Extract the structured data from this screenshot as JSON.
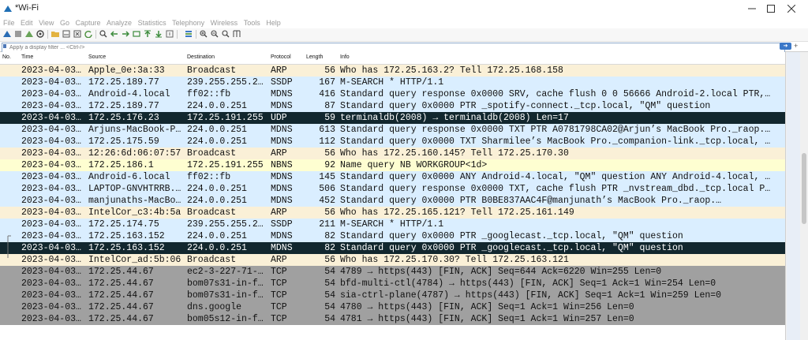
{
  "window": {
    "title": "*Wi-Fi"
  },
  "menu": [
    "File",
    "Edit",
    "View",
    "Go",
    "Capture",
    "Analyze",
    "Statistics",
    "Telephony",
    "Wireless",
    "Tools",
    "Help"
  ],
  "filter": {
    "placeholder": "Apply a display filter ... <Ctrl-/>"
  },
  "columns": {
    "no": "No.",
    "time": "Time",
    "source": "Source",
    "destination": "Destination",
    "protocol": "Protocol",
    "length": "Length",
    "info": "Info"
  },
  "colors": {
    "arp": "#faf0d7",
    "udp_blue": "#daeeff",
    "nbns": "#fefed1",
    "tcp_fin": "#a0a0a0",
    "selected": "#12272e",
    "selected_text": "#ffffff"
  },
  "rows": [
    {
      "time": "2023-04-03…",
      "source": "Apple_0e:3a:33",
      "destination": "Broadcast",
      "protocol": "ARP",
      "length": "56",
      "info": "Who has 172.25.163.2? Tell 172.25.168.158",
      "style": "arp"
    },
    {
      "time": "2023-04-03…",
      "source": "172.25.189.77",
      "destination": "239.255.255.2…",
      "protocol": "SSDP",
      "length": "167",
      "info": "M-SEARCH * HTTP/1.1",
      "style": "udp_blue"
    },
    {
      "time": "2023-04-03…",
      "source": "Android-4.local",
      "destination": "ff02::fb",
      "protocol": "MDNS",
      "length": "416",
      "info": "Standard query response 0x0000 SRV, cache flush 0 0 56666 Android-2.local PTR,…",
      "style": "udp_blue"
    },
    {
      "time": "2023-04-03…",
      "source": "172.25.189.77",
      "destination": "224.0.0.251",
      "protocol": "MDNS",
      "length": "87",
      "info": "Standard query 0x0000 PTR _spotify-connect._tcp.local, \"QM\" question",
      "style": "udp_blue"
    },
    {
      "time": "2023-04-03…",
      "source": "172.25.176.23",
      "destination": "172.25.191.255",
      "protocol": "UDP",
      "length": "59",
      "info": "terminaldb(2008) → terminaldb(2008) Len=17",
      "style": "selected"
    },
    {
      "time": "2023-04-03…",
      "source": "Arjuns-MacBook-P…",
      "destination": "224.0.0.251",
      "protocol": "MDNS",
      "length": "613",
      "info": "Standard query response 0x0000 TXT PTR A0781798CA02@Arjun’s MacBook Pro._raop.…",
      "style": "udp_blue"
    },
    {
      "time": "2023-04-03…",
      "source": "172.25.175.59",
      "destination": "224.0.0.251",
      "protocol": "MDNS",
      "length": "112",
      "info": "Standard query 0x0000 TXT Sharmilee’s MacBook Pro._companion-link._tcp.local, …",
      "style": "udp_blue"
    },
    {
      "time": "2023-04-03…",
      "source": "12:26:6d:06:07:57",
      "destination": "Broadcast",
      "protocol": "ARP",
      "length": "56",
      "info": "Who has 172.25.160.145? Tell 172.25.170.30",
      "style": "arp"
    },
    {
      "time": "2023-04-03…",
      "source": "172.25.186.1",
      "destination": "172.25.191.255",
      "protocol": "NBNS",
      "length": "92",
      "info": "Name query NB WORKGROUP<1d>",
      "style": "nbns"
    },
    {
      "time": "2023-04-03…",
      "source": "Android-6.local",
      "destination": "ff02::fb",
      "protocol": "MDNS",
      "length": "145",
      "info": "Standard query 0x0000 ANY Android-4.local, \"QM\" question ANY Android-4.local, …",
      "style": "udp_blue"
    },
    {
      "time": "2023-04-03…",
      "source": "LAPTOP-GNVHTRRB.…",
      "destination": "224.0.0.251",
      "protocol": "MDNS",
      "length": "506",
      "info": "Standard query response 0x0000 TXT, cache flush PTR _nvstream_dbd._tcp.local P…",
      "style": "udp_blue"
    },
    {
      "time": "2023-04-03…",
      "source": "manjunaths-MacBo…",
      "destination": "224.0.0.251",
      "protocol": "MDNS",
      "length": "452",
      "info": "Standard query 0x0000 PTR B0BE837AAC4F@manjunath’s MacBook Pro._raop.…",
      "style": "udp_blue"
    },
    {
      "time": "2023-04-03…",
      "source": "IntelCor_c3:4b:5a",
      "destination": "Broadcast",
      "protocol": "ARP",
      "length": "56",
      "info": "Who has 172.25.165.121? Tell 172.25.161.149",
      "style": "arp"
    },
    {
      "time": "2023-04-03…",
      "source": "172.25.174.75",
      "destination": "239.255.255.2…",
      "protocol": "SSDP",
      "length": "211",
      "info": "M-SEARCH * HTTP/1.1",
      "style": "udp_blue"
    },
    {
      "time": "2023-04-03…",
      "source": "172.25.163.152",
      "destination": "224.0.0.251",
      "protocol": "MDNS",
      "length": "82",
      "info": "Standard query 0x0000 PTR _googlecast._tcp.local, \"QM\" question",
      "style": "udp_blue"
    },
    {
      "time": "2023-04-03…",
      "source": "172.25.163.152",
      "destination": "224.0.0.251",
      "protocol": "MDNS",
      "length": "82",
      "info": "Standard query 0x0000 PTR _googlecast._tcp.local, \"QM\" question",
      "style": "selected"
    },
    {
      "time": "2023-04-03…",
      "source": "IntelCor_ad:5b:06",
      "destination": "Broadcast",
      "protocol": "ARP",
      "length": "56",
      "info": "Who has 172.25.170.30? Tell 172.25.163.121",
      "style": "arp"
    },
    {
      "time": "2023-04-03…",
      "source": "172.25.44.67",
      "destination": "ec2-3-227-71-…",
      "protocol": "TCP",
      "length": "54",
      "info": "4789 → https(443) [FIN, ACK] Seq=644 Ack=6220 Win=255 Len=0",
      "style": "tcp_fin"
    },
    {
      "time": "2023-04-03…",
      "source": "172.25.44.67",
      "destination": "bom07s31-in-f…",
      "protocol": "TCP",
      "length": "54",
      "info": "bfd-multi-ctl(4784) → https(443) [FIN, ACK] Seq=1 Ack=1 Win=254 Len=0",
      "style": "tcp_fin"
    },
    {
      "time": "2023-04-03…",
      "source": "172.25.44.67",
      "destination": "bom07s31-in-f…",
      "protocol": "TCP",
      "length": "54",
      "info": "sia-ctrl-plane(4787) → https(443) [FIN, ACK] Seq=1 Ack=1 Win=259 Len=0",
      "style": "tcp_fin"
    },
    {
      "time": "2023-04-03…",
      "source": "172.25.44.67",
      "destination": "dns.google",
      "protocol": "TCP",
      "length": "54",
      "info": "4780 → https(443) [FIN, ACK] Seq=1 Ack=1 Win=256 Len=0",
      "style": "tcp_fin"
    },
    {
      "time": "2023-04-03…",
      "source": "172.25.44.67",
      "destination": "bom05s12-in-f…",
      "protocol": "TCP",
      "length": "54",
      "info": "4781 → https(443) [FIN, ACK] Seq=1 Ack=1 Win=257 Len=0",
      "style": "tcp_fin"
    }
  ]
}
